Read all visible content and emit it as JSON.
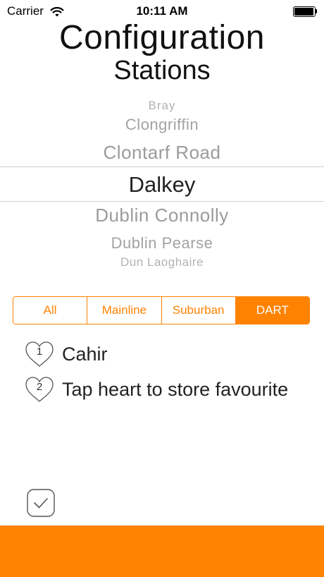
{
  "status_bar": {
    "carrier": "Carrier",
    "time": "10:11 AM"
  },
  "header": {
    "title": "Configuration",
    "subtitle": "Stations"
  },
  "picker": {
    "items": [
      "Bray",
      "Clongriffin",
      "Clontarf Road",
      "Dalkey",
      "Dublin Connolly",
      "Dublin Pearse",
      "Dun Laoghaire"
    ],
    "selected": "Dalkey"
  },
  "filter": {
    "segments": [
      "All",
      "Mainline",
      "Suburban",
      "DART"
    ],
    "selected": "DART"
  },
  "favourites": [
    {
      "number": "1",
      "label": "Cahir"
    },
    {
      "number": "2",
      "label": "Tap heart to store favourite"
    }
  ],
  "colors": {
    "accent": "#ff8201",
    "picker_inactive": "#9c9c9c",
    "picker_selected": "#222222"
  },
  "icons": {
    "wifi": "wifi-icon",
    "battery": "battery-icon",
    "heart": "heart-icon",
    "check": "checkmark-icon"
  }
}
